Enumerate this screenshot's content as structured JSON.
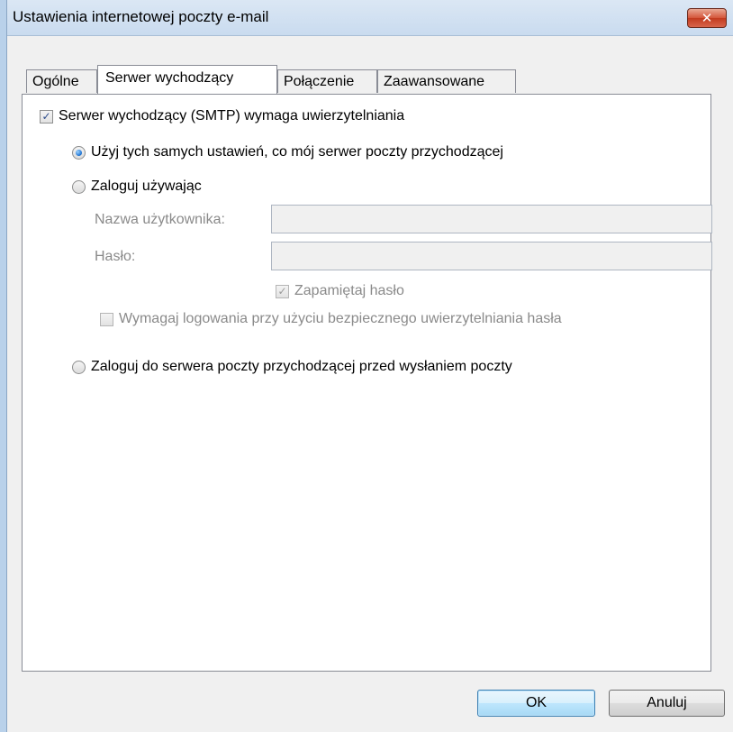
{
  "window": {
    "title": "Ustawienia internetowej poczty e-mail",
    "close_glyph": "✕"
  },
  "tabs": [
    {
      "label": "Ogólne",
      "active": false
    },
    {
      "label": "Serwer wychodzący",
      "active": true
    },
    {
      "label": "Połączenie",
      "active": false
    },
    {
      "label": "Zaawansowane",
      "active": false
    }
  ],
  "outgoing": {
    "smtp_auth": {
      "label": "Serwer wychodzący (SMTP) wymaga uwierzytelniania",
      "checked": true
    },
    "use_same": {
      "label": "Użyj tych samych ustawień, co mój serwer poczty przychodzącej",
      "selected": true
    },
    "login_using": {
      "label": "Zaloguj używając",
      "selected": false
    },
    "username": {
      "label": "Nazwa użytkownika:",
      "value": ""
    },
    "password": {
      "label": "Hasło:",
      "value": ""
    },
    "remember": {
      "label": "Zapamiętaj hasło",
      "checked": true
    },
    "spa": {
      "label": "Wymagaj logowania przy użyciu bezpiecznego uwierzytelniania hasła",
      "checked": false
    },
    "pop_before_smtp": {
      "label": "Zaloguj do serwera poczty przychodzącej przed wysłaniem poczty",
      "selected": false
    }
  },
  "buttons": {
    "ok": "OK",
    "cancel": "Anuluj"
  },
  "checkmark_glyph": "✓"
}
